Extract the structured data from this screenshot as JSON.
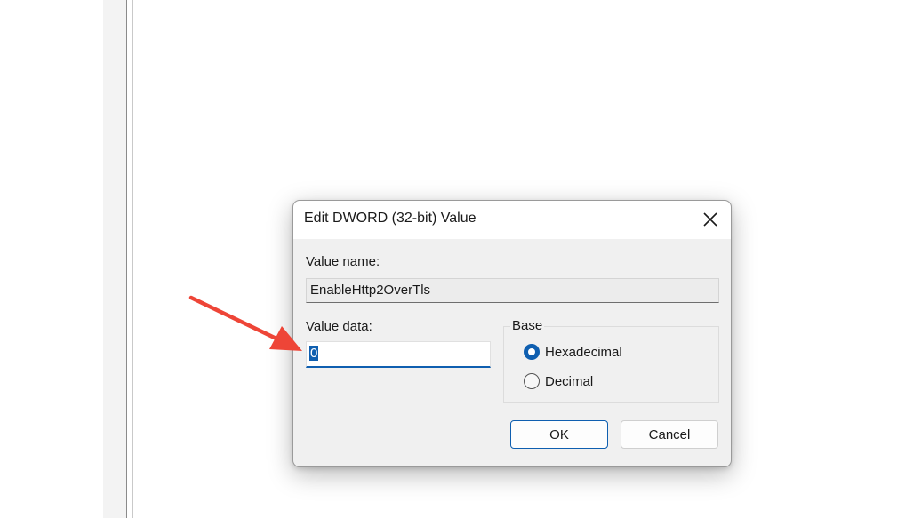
{
  "dialog": {
    "title": "Edit DWORD (32-bit) Value",
    "value_name_label": "Value name:",
    "value_name": "EnableHttp2OverTls",
    "value_data_label": "Value data:",
    "value_data": "0",
    "base_label": "Base",
    "base_options": [
      {
        "label": "Hexadecimal",
        "selected": true
      },
      {
        "label": "Decimal",
        "selected": false
      }
    ],
    "ok_label": "OK",
    "cancel_label": "Cancel"
  },
  "icons": {
    "close": "close-icon",
    "annotation": "red-arrow-icon"
  },
  "colors": {
    "accent": "#0f5fb0",
    "annotation_arrow": "#ee4537",
    "dialog_bg": "#f0f0f0"
  }
}
